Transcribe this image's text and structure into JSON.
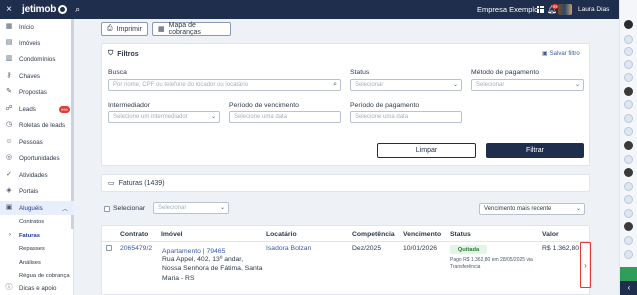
{
  "topbar": {
    "close_icon": "×",
    "logo_text": "jetimob",
    "search_icon": "⌕",
    "company": "Empresa Exemplo",
    "bell_badge": "99",
    "user_name": "Laura Dias"
  },
  "sidebar": {
    "items": [
      {
        "label": "Início",
        "icon": "▦"
      },
      {
        "label": "Imóveis",
        "icon": "▤"
      },
      {
        "label": "Condomínios",
        "icon": "▥"
      },
      {
        "label": "Chaves",
        "icon": "⚷"
      },
      {
        "label": "Propostas",
        "icon": "✎"
      },
      {
        "label": "Leads",
        "icon": "☍",
        "badge": "999"
      },
      {
        "label": "Roletas de leads",
        "icon": "◷"
      },
      {
        "label": "Pessoas",
        "icon": "☺"
      },
      {
        "label": "Oportunidades",
        "icon": "◎"
      },
      {
        "label": "Atividades",
        "icon": "✓"
      },
      {
        "label": "Portais",
        "icon": "◈"
      },
      {
        "label": "Aluguéis",
        "icon": "▣",
        "caret": "︿"
      }
    ],
    "subitems": [
      "Contratos",
      "Faturas",
      "Repasses",
      "Análises",
      "Régua de cobrança"
    ],
    "help": {
      "label": "Dicas e apoio",
      "icon": "ⓘ"
    }
  },
  "actions": {
    "print_label": "Imprimir",
    "print_icon": "⎙",
    "map_label": "Mapa de cobranças",
    "map_icon": "▦"
  },
  "filters": {
    "title": "Filtros",
    "title_icon": "⛉",
    "save_label": "Salvar filtro",
    "save_icon": "▣",
    "busca_label": "Busca",
    "busca_placeholder": "Por nome, CPF ou telefone do locador ou locatário",
    "status_label": "Status",
    "status_placeholder": "Selecionar",
    "metodo_label": "Método de pagamento",
    "metodo_placeholder": "Selecionar",
    "intermediador_label": "Intermediador",
    "intermediador_placeholder": "Selecione um intermediador",
    "vencimento_label": "Período de vencimento",
    "vencimento_placeholder": "Selecione uma data",
    "pagamento_label": "Período de pagamento",
    "pagamento_placeholder": "Selecione uma data",
    "clear_label": "Limpar",
    "filter_label": "Filtrar"
  },
  "faturas": {
    "title": "Faturas (1439)",
    "title_icon": "▭",
    "select_label": "Selecionar",
    "select_placeholder": "Selecionar",
    "sort_value": "Vencimento mais recente",
    "columns": [
      "Contrato",
      "Imóvel",
      "Locatário",
      "Competência",
      "Vencimento",
      "Status",
      "Valor"
    ],
    "rows": [
      {
        "contrato": "2065479/2",
        "imovel_title": "Apartamento | 79465",
        "imovel_line1": "Rua Appel, 402, 13º andar,",
        "imovel_line2": "Nossa Senhora de Fátima, Santa",
        "imovel_line3": "Maria - RS",
        "locatario": "Isadora Bolzan",
        "competencia": "Dez/2025",
        "vencimento": "10/01/2026",
        "status": "Quitada",
        "status_note": "Pago R$ 1.362,80 em 28/05/2025 via Transferência",
        "valor": "R$ 1.362,80"
      }
    ]
  }
}
